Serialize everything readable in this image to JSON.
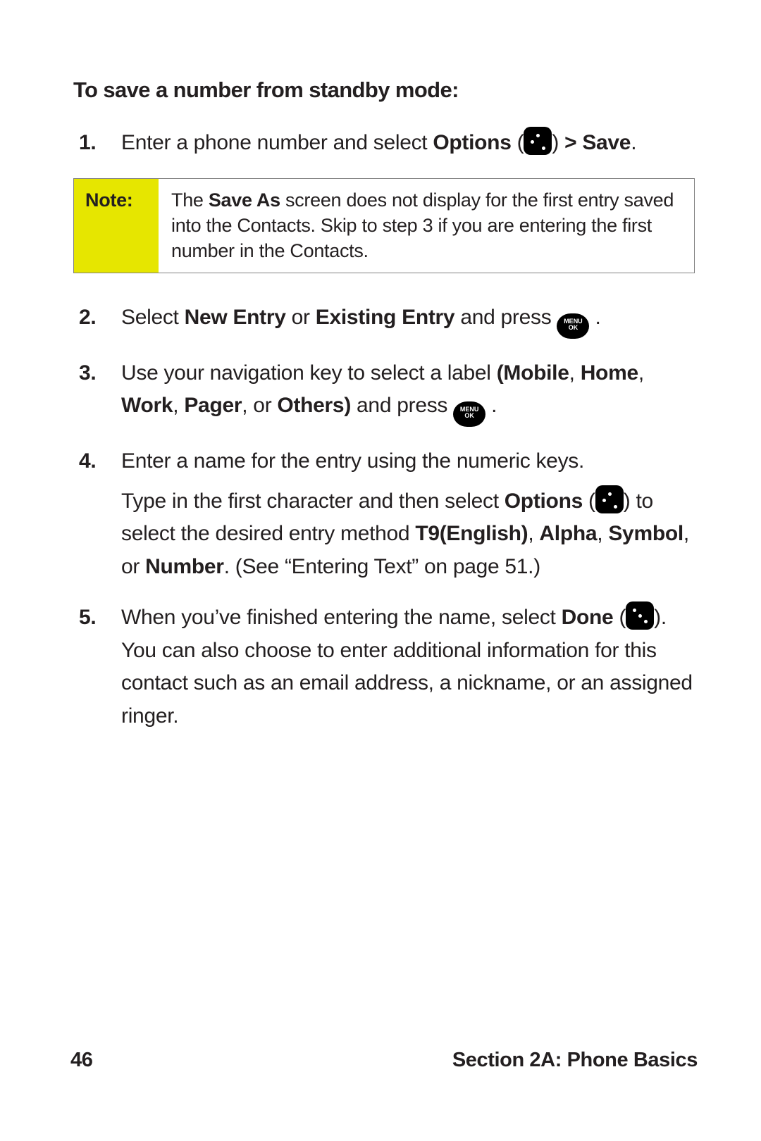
{
  "heading": "To save a number from standby mode:",
  "steps": {
    "s1": {
      "num": "1.",
      "t1": "Enter a phone number and select ",
      "options": "Options",
      "paren_open": " (",
      "paren_close": ") ",
      "gt_save": "> Save",
      "period": "."
    },
    "s2": {
      "num": "2.",
      "t1": "Select ",
      "new_entry": "New Entry",
      "or": " or ",
      "existing_entry": "Existing Entry",
      "and_press": " and press ",
      "period": " ."
    },
    "s3": {
      "num": "3.",
      "t1": "Use your navigation key to select a label ",
      "labels_bold": "(Mobile",
      "comma1": ", ",
      "home": "Home",
      "comma2": ", ",
      "work": "Work",
      "comma3": ", ",
      "pager": "Pager",
      "comma_or": ", or ",
      "others": "Others)",
      "and_press": " and press ",
      "period": " ."
    },
    "s4": {
      "num": "4.",
      "p1_a": "Enter a name for the entry using the numeric keys.",
      "p2_a": "Type in the first character and then select ",
      "options": "Options",
      "paren_open": " (",
      "paren_close": ") ",
      "p2_b": "to select the desired entry method ",
      "t9": "T9(English)",
      "comma1": ", ",
      "alpha": "Alpha",
      "comma2": ", ",
      "symbol": "Symbol",
      "comma_or": ", or ",
      "number": "Number",
      "p2_c": ". (See “Entering Text” on page 51.)"
    },
    "s5": {
      "num": "5.",
      "t1": "When you’ve finished entering the name, select ",
      "done": "Done",
      "paren_open": " (",
      "paren_close": "). ",
      "t2": "You can also choose to enter additional information for this contact such as an email address, a nickname, or an assigned ringer."
    }
  },
  "note": {
    "label": "Note:",
    "b1": "The ",
    "save_as": "Save As",
    "b2": " screen does not display for the first entry saved into the Contacts. Skip to step 3 if you are entering the first number in the Contacts."
  },
  "menuok": {
    "line1": "MENU",
    "line2": "OK"
  },
  "footer": {
    "page": "46",
    "section": "Section 2A: Phone Basics"
  }
}
